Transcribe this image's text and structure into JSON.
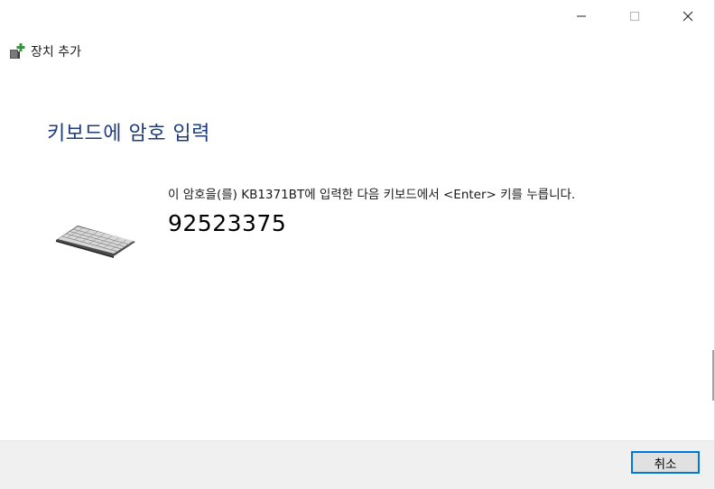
{
  "window": {
    "title": "장치 추가",
    "controls": {
      "minimize_icon": "minimize-icon",
      "maximize_icon": "maximize-icon",
      "close_icon": "close-icon"
    }
  },
  "main": {
    "heading": "키보드에 암호 입력",
    "instruction": "이 암호을(를) KB1371BT에 입력한 다음 키보드에서 <Enter> 키를 누릅니다.",
    "passcode": "92523375",
    "device_icon": "keyboard-icon"
  },
  "footer": {
    "cancel_label": "취소"
  },
  "colors": {
    "heading": "#1f3d7a",
    "accent": "#0078d7",
    "footer_bg": "#f0f0f0"
  }
}
